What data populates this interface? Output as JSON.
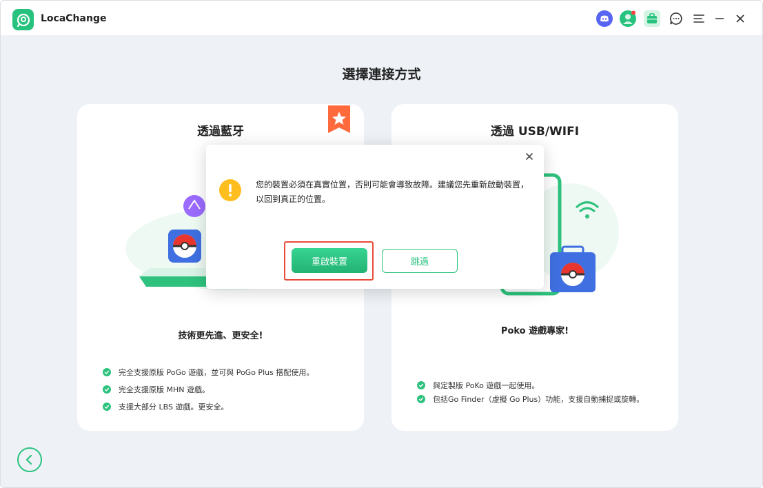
{
  "app": {
    "title": "LocaChange"
  },
  "titlebar": {
    "icons": [
      "discord-icon",
      "profile-icon",
      "toolbox-icon",
      "chat-icon",
      "menu-icon",
      "minimize-icon",
      "close-icon"
    ],
    "accent": "#27c27e"
  },
  "main": {
    "heading": "選擇連接方式"
  },
  "cards": {
    "bluetooth": {
      "title": "透過藍牙",
      "subtitle": "技術更先進、更安全!",
      "features": [
        "完全支援原版 PoGo 遊戲，並可與 PoGo Plus 搭配使用。",
        "完全支援原版 MHN 遊戲。",
        "支援大部分 LBS 遊戲。更安全。"
      ]
    },
    "usb": {
      "title": "透過 USB/WIFI",
      "subtitle": "Poko 遊戲專家!",
      "features": [
        "與定製版 PoKo 遊戲一起使用。",
        "包括Go Finder（虛擬 Go Plus）功能，支援自動捕捉或旋轉。"
      ]
    }
  },
  "dialog": {
    "message": "您的裝置必須在真實位置，否則可能會導致故障。建議您先重新啟動裝置，以回到真正的位置。",
    "primary_label": "重啟裝置",
    "secondary_label": "跳過",
    "highlight_color": "#e84a3a"
  }
}
